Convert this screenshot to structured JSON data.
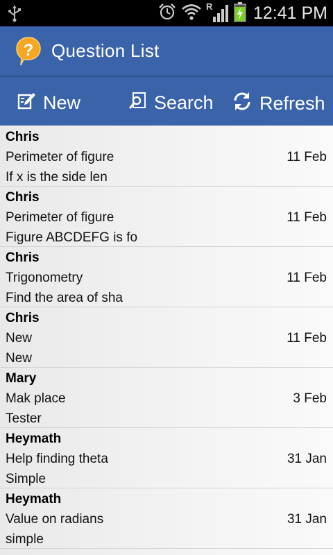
{
  "status_bar": {
    "time": "12:41 PM",
    "roaming_label": "R"
  },
  "app": {
    "title": "Question List"
  },
  "actions": {
    "new_label": "New",
    "search_label": "Search",
    "refresh_label": "Refresh"
  },
  "questions": [
    {
      "author": "Chris",
      "subject": "Perimeter of figure",
      "date": "11 Feb",
      "preview": "If x is the side len"
    },
    {
      "author": "Chris",
      "subject": "Perimeter of figure",
      "date": "11 Feb",
      "preview": "Figure ABCDEFG is fo"
    },
    {
      "author": "Chris",
      "subject": "Trigonometry",
      "date": "11 Feb",
      "preview": "Find the area of sha"
    },
    {
      "author": "Chris",
      "subject": "New",
      "date": "11 Feb",
      "preview": "New"
    },
    {
      "author": "Mary",
      "subject": "Mak place",
      "date": "3 Feb",
      "preview": "Tester"
    },
    {
      "author": "Heymath",
      "subject": "Help finding theta",
      "date": "31 Jan",
      "preview": "Simple"
    },
    {
      "author": "Heymath",
      "subject": "Value on radians",
      "date": "31 Jan",
      "preview": "simple"
    }
  ],
  "colors": {
    "header": "#3b63a9",
    "logo_orange": "#f5a623",
    "battery_green": "#7bd21e"
  }
}
